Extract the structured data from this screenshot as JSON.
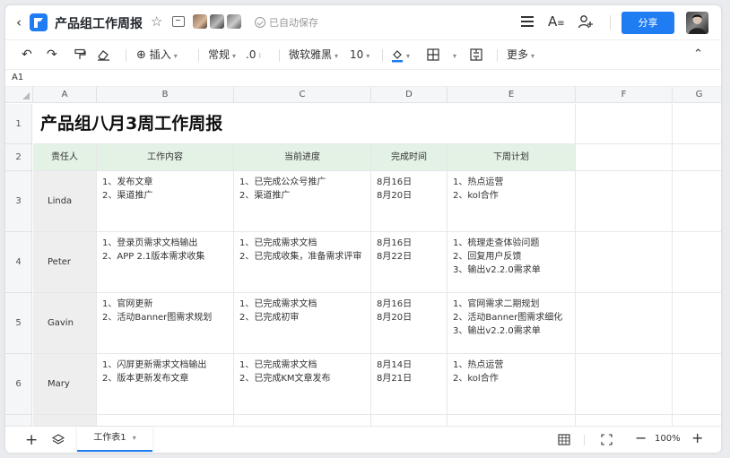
{
  "header": {
    "title": "产品组工作周报",
    "save_status": "已自动保存",
    "share_label": "分享"
  },
  "toolbar": {
    "insert_label": "插入",
    "format_label": "常规",
    "decimal_label": ".0",
    "font_label": "微软雅黑",
    "size_label": "10",
    "more_label": "更多"
  },
  "cell_ref": "A1",
  "columns": [
    "A",
    "B",
    "C",
    "D",
    "E",
    "F",
    "G"
  ],
  "rows": [
    "1",
    "2",
    "3",
    "4",
    "5",
    "6"
  ],
  "sheet": {
    "title": "产品组八月3周工作周报",
    "headers": [
      "责任人",
      "工作内容",
      "当前进度",
      "完成时间",
      "下周计划"
    ],
    "records": [
      {
        "owner": "Linda",
        "work": [
          "1、发布文章",
          "2、渠道推广"
        ],
        "progress": [
          "1、已完成公众号推广",
          "2、渠道推广"
        ],
        "dates": [
          "8月16日",
          "8月20日"
        ],
        "plan": [
          "1、热点运营",
          "2、kol合作"
        ]
      },
      {
        "owner": "Peter",
        "work": [
          "1、登录页需求文档输出",
          "2、APP 2.1版本需求收集"
        ],
        "progress": [
          "1、已完成需求文档",
          "2、已完成收集，准备需求评审"
        ],
        "dates": [
          "8月16日",
          "8月22日"
        ],
        "plan": [
          "1、梳理走查体验问题",
          "2、回复用户反馈",
          "3、输出v2.2.0需求单"
        ]
      },
      {
        "owner": "Gavin",
        "work": [
          "1、官网更新",
          "2、活动Banner图需求规划"
        ],
        "progress": [
          "1、已完成需求文档",
          "2、已完成初审"
        ],
        "dates": [
          "8月16日",
          "8月20日"
        ],
        "plan": [
          "1、官网需求二期规划",
          "2、活动Banner图需求细化",
          "3、输出v2.2.0需求单"
        ]
      },
      {
        "owner": "Mary",
        "work": [
          "1、闪屏更新需求文档输出",
          "2、版本更新发布文章"
        ],
        "progress": [
          "1、已完成需求文档",
          "2、已完成KM文章发布"
        ],
        "dates": [
          "8月14日",
          "8月21日"
        ],
        "plan": [
          "1、热点运营",
          "2、kol合作"
        ]
      }
    ]
  },
  "footer": {
    "sheet_tab": "工作表1",
    "zoom": "100%"
  },
  "colors": {
    "accent": "#1f7cf3",
    "header_row_bg": "#e3f2e4",
    "owner_cell_bg": "#eeeeee"
  }
}
